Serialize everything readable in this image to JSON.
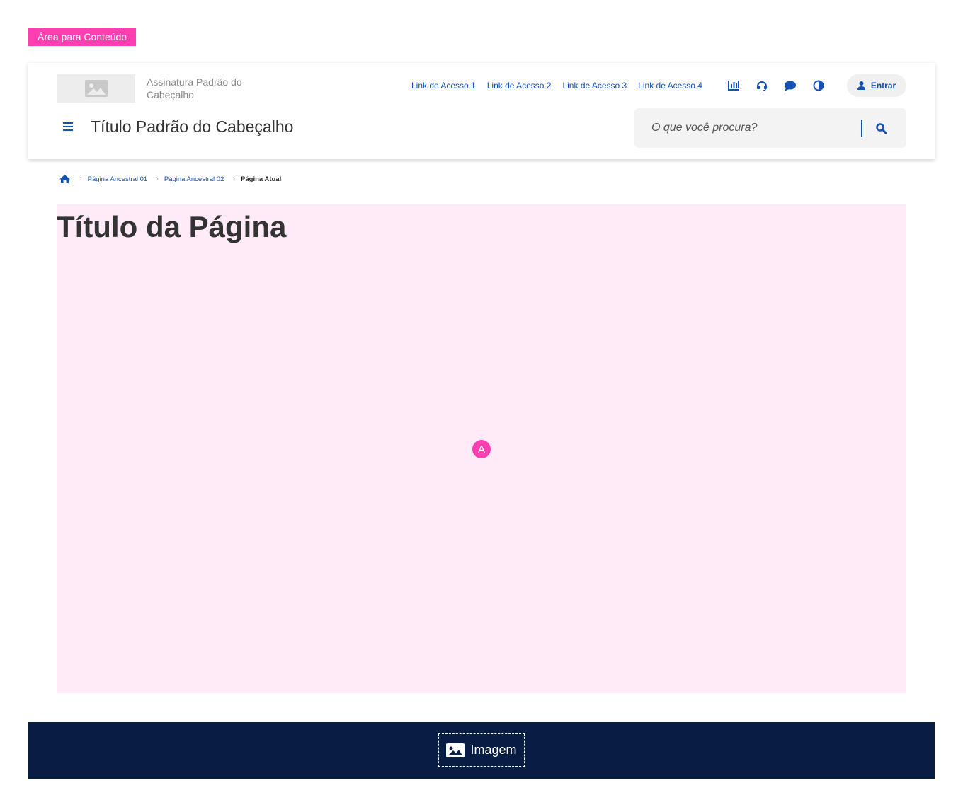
{
  "content_area_tag": "Área para Conteúdo",
  "header": {
    "signature": "Assinatura Padrão do Cabeçalho",
    "links": [
      "Link de Acesso 1",
      "Link de Acesso 2",
      "Link de Acesso 3",
      "Link de Acesso 4"
    ],
    "icons": [
      "chart-icon",
      "headset-icon",
      "chat-icon",
      "contrast-icon"
    ],
    "login_label": "Entrar",
    "title": "Título Padrão do Cabeçalho",
    "search_placeholder": "O que você procura?"
  },
  "breadcrumb": {
    "items": [
      "Página Ancestral 01",
      "Página Ancestral 02"
    ],
    "current": "Página Atual"
  },
  "main": {
    "title": "Título da Página",
    "marker": "A"
  },
  "footer": {
    "image_label": "Imagem"
  },
  "colors": {
    "primary": "#1351b4",
    "accent": "#ff3fb1",
    "content_bg": "#ffebf7",
    "footer_bg": "#071d41"
  }
}
